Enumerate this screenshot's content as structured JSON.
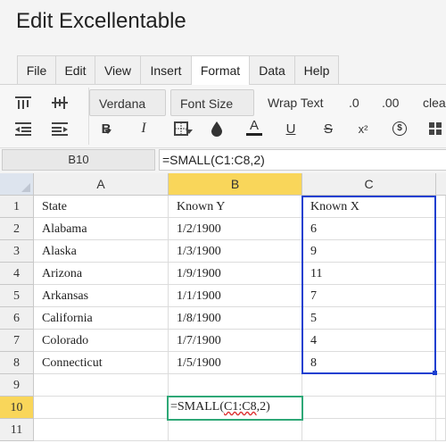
{
  "window": {
    "title": "Edit Excellentable"
  },
  "menu": {
    "items": [
      "File",
      "Edit",
      "View",
      "Insert",
      "Format",
      "Data",
      "Help"
    ],
    "active": "Format"
  },
  "toolbar": {
    "font_family": "Verdana",
    "font_size": "Font Size",
    "wrap_text": "Wrap Text",
    "decrease_decimal": ".0",
    "increase_decimal": ".00",
    "clear": "clea",
    "bold": "B",
    "italic": "I",
    "strikethrough": "S",
    "superscript": "x²",
    "text_color": "A",
    "underline": "U",
    "currency": "$"
  },
  "formula_bar": {
    "cell_ref": "B10",
    "formula": "=SMALL(C1:C8,2)"
  },
  "sheet": {
    "columns": [
      "A",
      "B",
      "C"
    ],
    "selected_column": "B",
    "selected_row": "10",
    "rows": [
      {
        "num": "1",
        "cells": [
          "State",
          "Known Y",
          "Known X"
        ]
      },
      {
        "num": "2",
        "cells": [
          "Alabama",
          "1/2/1900",
          "6"
        ]
      },
      {
        "num": "3",
        "cells": [
          "Alaska",
          "1/3/1900",
          "9"
        ]
      },
      {
        "num": "4",
        "cells": [
          "Arizona",
          "1/9/1900",
          "11"
        ]
      },
      {
        "num": "5",
        "cells": [
          "Arkansas",
          "1/1/1900",
          "7"
        ]
      },
      {
        "num": "6",
        "cells": [
          "California",
          "1/8/1900",
          "5"
        ]
      },
      {
        "num": "7",
        "cells": [
          "Colorado",
          "1/7/1900",
          "4"
        ]
      },
      {
        "num": "8",
        "cells": [
          "Connecticut",
          "1/5/1900",
          "8"
        ]
      },
      {
        "num": "9",
        "cells": [
          "",
          "",
          ""
        ]
      },
      {
        "num": "10",
        "cells": [
          "",
          "",
          ""
        ]
      },
      {
        "num": "11",
        "cells": [
          "",
          "",
          ""
        ]
      }
    ],
    "editor": {
      "prefix": "=SMALL(",
      "range": "C1:C8",
      "suffix": ",2)"
    }
  }
}
